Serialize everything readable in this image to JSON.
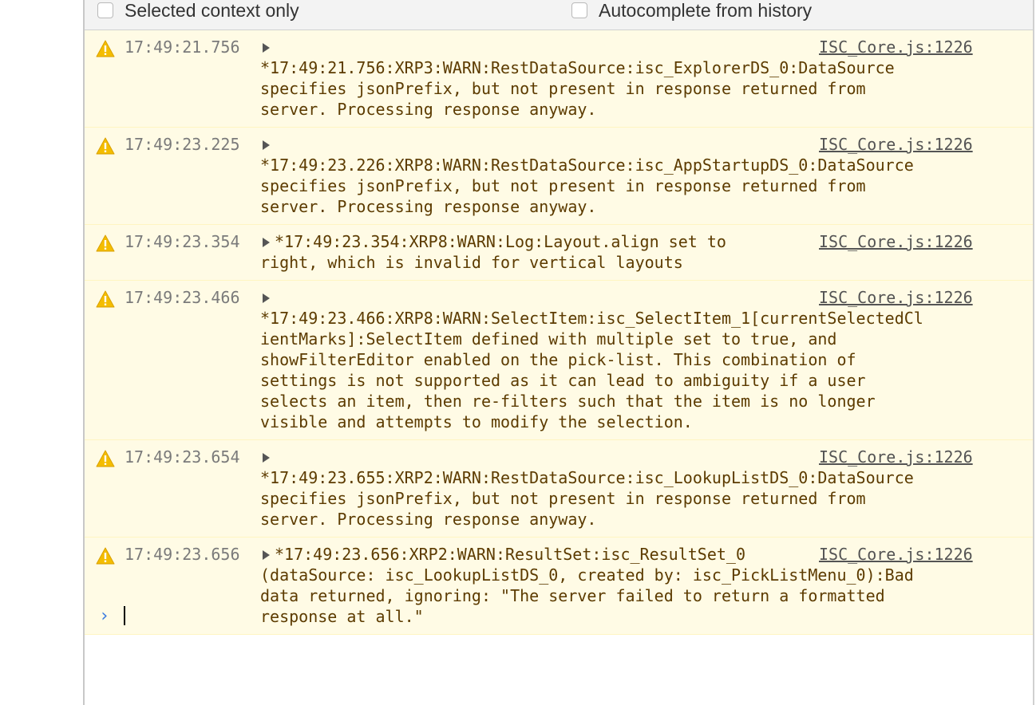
{
  "toolbar": {
    "selected_context_label": "Selected context only",
    "autocomplete_label": "Autocomplete from history"
  },
  "messages": [
    {
      "time": "17:49:21.756",
      "source": "ISC_Core.js:1226",
      "lines": [
        "*17:49:21.756:XRP3:WARN:RestDataSource:isc_ExplorerDS_0:DataSource",
        "specifies jsonPrefix, but not present in response returned from",
        "server. Processing response anyway."
      ]
    },
    {
      "time": "17:49:23.225",
      "source": "ISC_Core.js:1226",
      "lines": [
        "*17:49:23.226:XRP8:WARN:RestDataSource:isc_AppStartupDS_0:DataSource",
        "specifies jsonPrefix, but not present in response returned from",
        "server. Processing response anyway."
      ]
    },
    {
      "time": "17:49:23.354",
      "source": "ISC_Core.js:1226",
      "lines": [
        "*17:49:23.354:XRP8:WARN:Log:Layout.align set to",
        "right, which is invalid for vertical layouts"
      ]
    },
    {
      "time": "17:49:23.466",
      "source": "ISC_Core.js:1226",
      "lines": [
        "*17:49:23.466:XRP8:WARN:SelectItem:isc_SelectItem_1[currentSelectedCl",
        "ientMarks]:SelectItem defined with multiple set to true, and",
        "showFilterEditor enabled on the pick-list. This combination of",
        "settings is not supported as it can lead to ambiguity if a user",
        "selects an item, then re-filters such that the item is no longer",
        "visible and attempts to modify the selection."
      ]
    },
    {
      "time": "17:49:23.654",
      "source": "ISC_Core.js:1226",
      "lines": [
        "*17:49:23.655:XRP2:WARN:RestDataSource:isc_LookupListDS_0:DataSource",
        "specifies jsonPrefix, but not present in response returned from",
        "server. Processing response anyway."
      ]
    },
    {
      "time": "17:49:23.656",
      "source": "ISC_Core.js:1226",
      "lines": [
        "*17:49:23.656:XRP2:WARN:ResultSet:isc_ResultSet_0",
        "(dataSource: isc_LookupListDS_0, created by: isc_PickListMenu_0):Bad",
        "data returned, ignoring: \"The server failed to return a formatted",
        "response at all.\""
      ]
    }
  ],
  "prompt": {
    "chevron": "›"
  },
  "colors": {
    "warning_bg": "#fffbe5",
    "warning_text": "#5c3b00",
    "warning_icon": "#f4bd00",
    "prompt_accent": "#3b7be0"
  },
  "icons": {
    "warning": "warning-triangle-icon",
    "expand": "disclosure-triangle-icon"
  }
}
